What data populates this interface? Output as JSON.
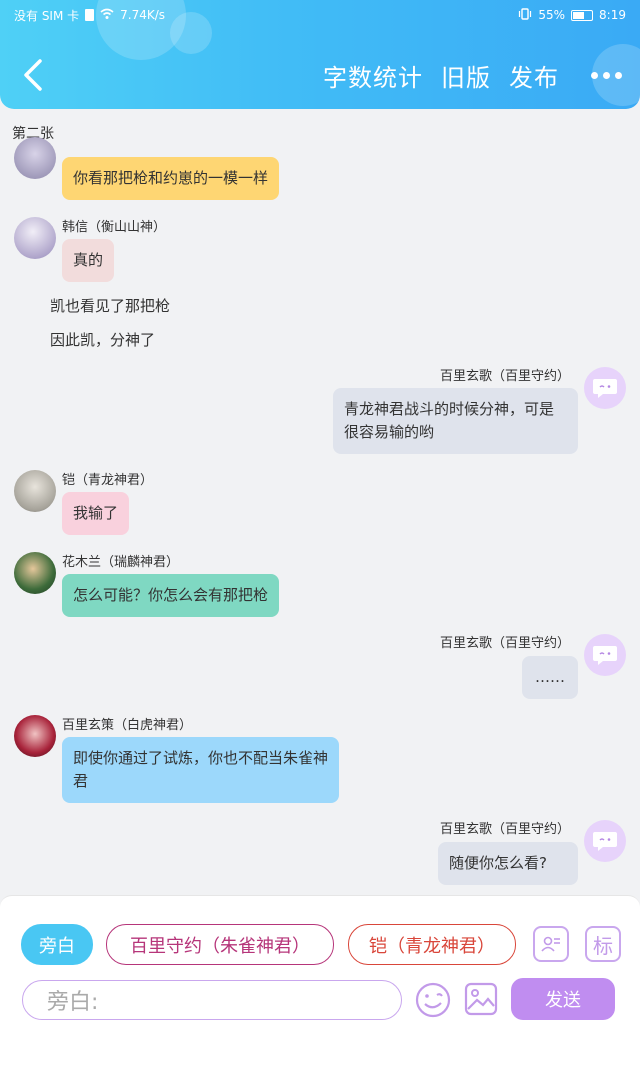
{
  "status_bar": {
    "carrier": "没有 SIM 卡",
    "speed": "7.74K/s",
    "battery": "55%",
    "time": "8:19"
  },
  "header": {
    "word_count_label": "字数统计",
    "old_version_label": "旧版",
    "publish_label": "发布",
    "back_icon": "chevron-left-icon",
    "more_icon": "more-dots-icon"
  },
  "chat": {
    "page_label": "第二张",
    "messages": [
      {
        "side": "left",
        "name": "",
        "text": "你看那把枪和约崽的一模一样",
        "color": "#fed673"
      },
      {
        "side": "left",
        "name": "韩信（衡山山神）",
        "text": "真的",
        "color": "#f2dcdc"
      },
      {
        "type": "narration",
        "text": "凯也看见了那把枪"
      },
      {
        "type": "narration",
        "text": "因此凯，分神了"
      },
      {
        "side": "right",
        "name": "百里玄歌（百里守约）",
        "text": "青龙神君战斗的时候分神，可是很容易输的哟",
        "color": "#dfe3ec"
      },
      {
        "side": "left",
        "name": "铠（青龙神君）",
        "text": "我输了",
        "color": "#f9d1dd"
      },
      {
        "side": "left",
        "name": "花木兰（瑞麟神君）",
        "text": "怎么可能？你怎么会有那把枪",
        "color": "#7fd8c2"
      },
      {
        "side": "right",
        "name": "百里玄歌（百里守约）",
        "text": "……",
        "color": "#dfe3ec"
      },
      {
        "side": "left",
        "name": "百里玄策（白虎神君）",
        "text": "即使你通过了试炼，你也不配当朱雀神君",
        "color": "#9cd8fb"
      },
      {
        "side": "right",
        "name": "百里玄歌（百里守约）",
        "text": "随便你怎么看?",
        "color": "#dfe3ec"
      }
    ]
  },
  "input_panel": {
    "roles": [
      "旁白",
      "百里守约（朱雀神君）",
      "铠（青龙神君）"
    ],
    "contacts_icon": "contact-card-icon",
    "tag_label": "标",
    "placeholder": "旁白:",
    "emoji_icon": "emoji-icon",
    "image_icon": "image-icon",
    "send_label": "发送"
  },
  "colors": {
    "header_gradient_start": "#4fd0f6",
    "header_gradient_end": "#3aaaf5",
    "accent_purple": "#c08df0",
    "narration_chip": "#49c7f3",
    "role_chip_magenta": "#b6357a",
    "role_chip_red": "#d9463a"
  }
}
